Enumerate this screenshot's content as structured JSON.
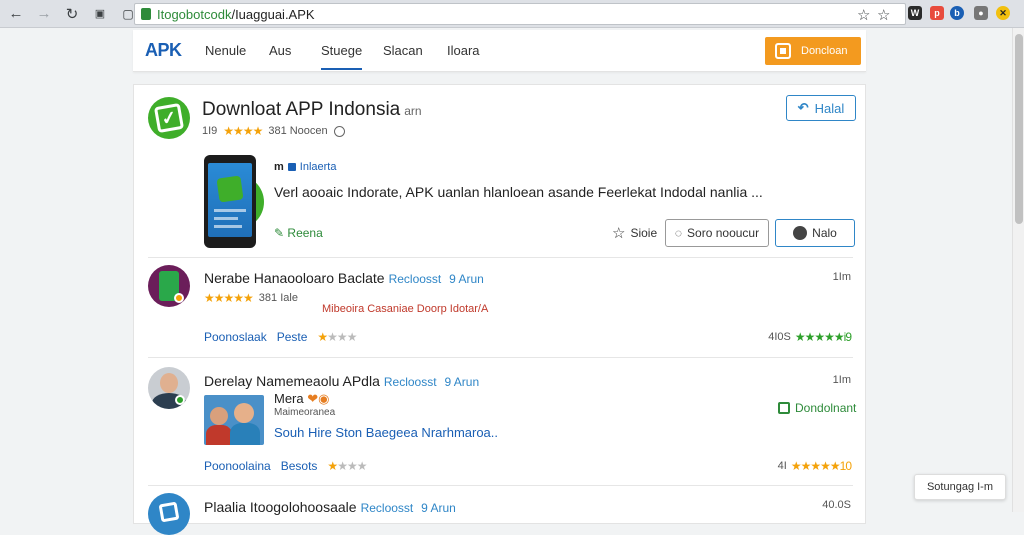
{
  "browser": {
    "url_host": "Itogobotcodk",
    "url_path": "/Iuagguai.APK"
  },
  "site": {
    "logo": "APK",
    "tabs": [
      "Nenule",
      "Aus",
      "Stuege",
      "Slacan",
      "Iloara"
    ],
    "active_tab": 2,
    "download_button": "Doncloan"
  },
  "app": {
    "title": "Downloat APP Indonsia",
    "title_suffix": "arn",
    "rating": "1I9",
    "stars": "★★★★",
    "downloads": "381 Noocen",
    "install_label": "Halal",
    "tag": "Inlaerta",
    "description": "Verl aooaic Indorate, APK uanlan hlanloean asande Feerlekat Indodal nanlia ...",
    "rate_link": "Reena",
    "actions": {
      "star": "Sioie",
      "secondary": "Soro nooucur",
      "primary": "Nalo"
    }
  },
  "reviews": [
    {
      "title": "Nerabe Hanaooloaro Baclate",
      "recommend": "Recloosst",
      "recommend_time": "9 Arun",
      "time": "1Im",
      "stars": "★★★★★",
      "meta": "381 Iale",
      "red_text": "Mibeoira Casaniae Doorp Idotar/A",
      "foot_a": "Poonoslaak",
      "foot_b": "Peste",
      "foot_stars": "★",
      "foot_stars_gray": "★★★",
      "right_value": "4I0S",
      "right_stars": "★★★★★i9"
    },
    {
      "title": "Derelay Namemeaolu APdla",
      "recommend": "Recloosst",
      "recommend_time": "9 Arun",
      "time": "1Im",
      "meta_title": "Mera",
      "meta_sub": "Maimeoranea",
      "link": "Souh Hire Ston Baegeea Nrarhmaroa..",
      "side_link": "Dondolnant",
      "foot_a": "Poonoolaina",
      "foot_b": "Besots",
      "foot_stars": "★",
      "foot_stars_gray": "★★★",
      "right_value": "4I",
      "right_stars": "★★★★★10"
    },
    {
      "title": "Plaalia Itoogolohoosaale",
      "recommend": "Recloosst",
      "recommend_time": "9 Arun",
      "time": "40.0S"
    }
  ],
  "toast": "Sotungag I-m"
}
